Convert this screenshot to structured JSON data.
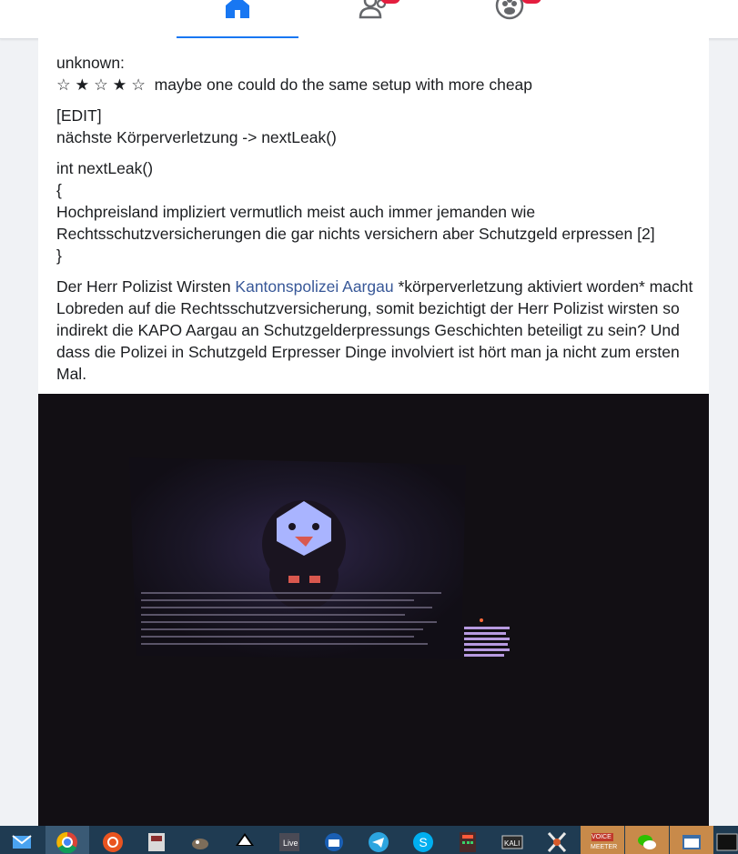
{
  "nav": {
    "tabs": [
      {
        "name": "home",
        "active": true
      },
      {
        "name": "friends",
        "badge": true
      },
      {
        "name": "groups",
        "badge": true
      }
    ],
    "accent": "#1877f2",
    "badge_color": "#e41e3f"
  },
  "post": {
    "rating_label": "unknown:",
    "rating_stars": "☆ ★ ☆ ★ ☆",
    "rating_comment": "maybe one could do the same setup with more cheap",
    "edit_tag": "[EDIT]",
    "edit_text": "nächste Körperverletzung -> nextLeak()",
    "code_sig": "int nextLeak()",
    "code_open": "{",
    "code_body": "Hochpreisland impliziert vermutlich meist auch immer jemanden wie Rechtsschutzversicherungen die gar nichts versichern aber Schutzgeld erpressen [2]",
    "code_close": "}",
    "para_before_link": "Der Herr Polizist Wirsten ",
    "link_text": "Kantonspolizei Aargau",
    "para_after_link": " *körperverletzung aktiviert worden* macht Lobreden auf die Rechtsschutzversicherung, somit bezichtigt der Herr Polizist wirsten so indirekt die KAPO Aargau an Schutzgelderpressungs Geschichten beteiligt zu sein? Und dass die Polizei in Schutzgeld Erpresser Dinge involviert ist hört man ja nicht zum ersten Mal."
  },
  "taskbar": {
    "items": [
      "mail-icon",
      "chrome-icon",
      "ubuntu-icon",
      "app-icon",
      "gimp-icon",
      "inkscape-icon",
      "live-icon",
      "thunderbird-icon",
      "telegram-icon",
      "skype-icon",
      "calculator-icon",
      "kali-icon",
      "x-icon",
      "voicemeeter-icon",
      "wechat-icon",
      "window-icon",
      "terminal-icon"
    ],
    "live_label": "Live",
    "kali_label": "KALI",
    "voice_label": "VOICE",
    "meeter_label": "MEETER"
  }
}
